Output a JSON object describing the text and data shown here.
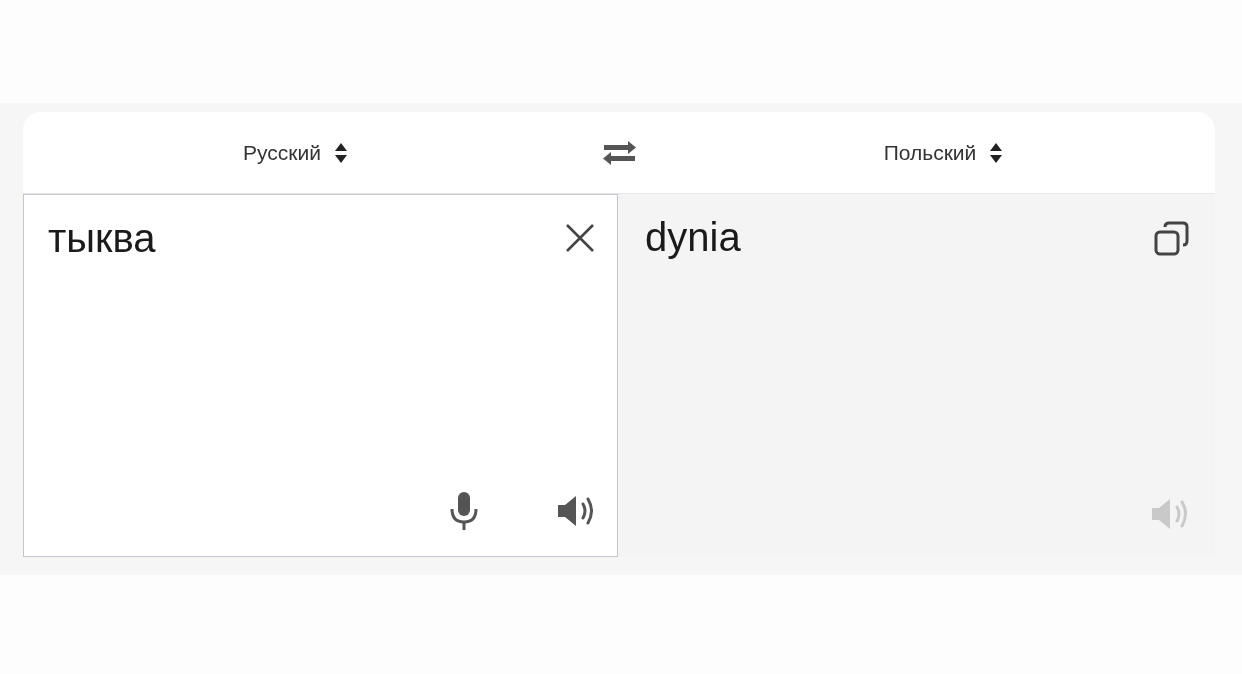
{
  "language_bar": {
    "source_language": "Русский",
    "target_language": "Польский"
  },
  "source_panel": {
    "text": "тыква",
    "listen_disabled": false
  },
  "target_panel": {
    "text": "dynia",
    "listen_disabled": true
  }
}
